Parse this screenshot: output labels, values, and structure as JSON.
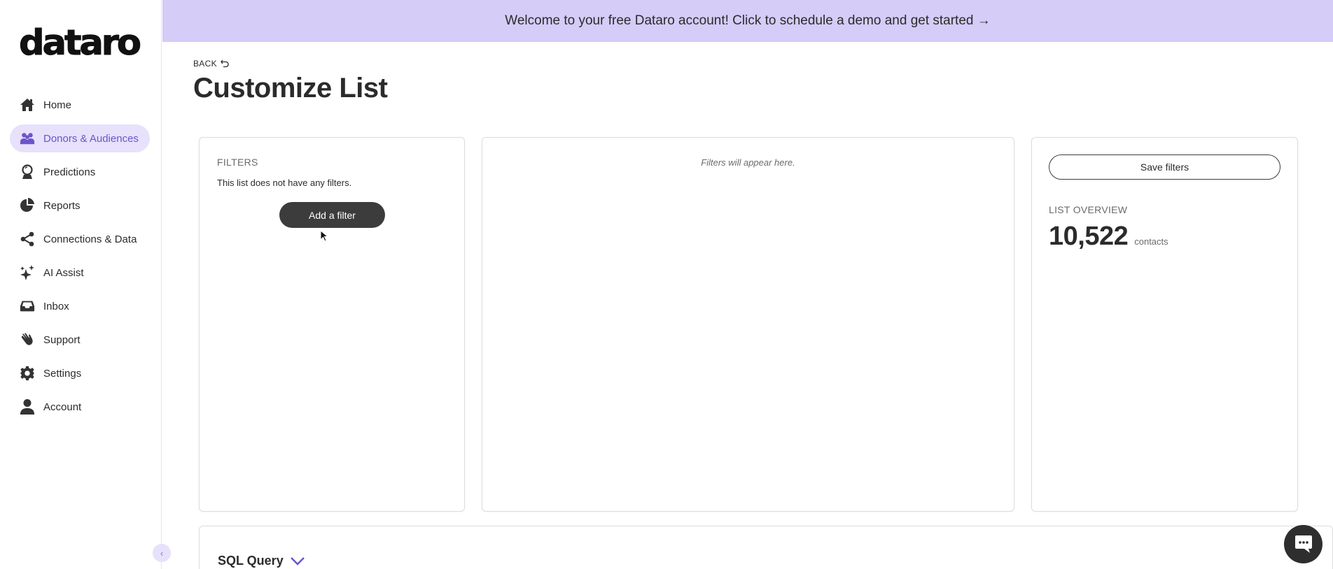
{
  "app": {
    "logo_text": "dataro"
  },
  "banner": {
    "text": "Welcome to your free Dataro account! Click to schedule a demo and get started →"
  },
  "sidebar": {
    "items": [
      {
        "label": "Home",
        "icon": "home-icon",
        "active": false
      },
      {
        "label": "Donors & Audiences",
        "icon": "people-icon",
        "active": true
      },
      {
        "label": "Predictions",
        "icon": "crystal-ball-icon",
        "active": false
      },
      {
        "label": "Reports",
        "icon": "pie-chart-icon",
        "active": false
      },
      {
        "label": "Connections & Data",
        "icon": "share-icon",
        "active": false
      },
      {
        "label": "AI Assist",
        "icon": "sparkle-icon",
        "active": false
      },
      {
        "label": "Inbox",
        "icon": "inbox-icon",
        "active": false
      },
      {
        "label": "Support",
        "icon": "waving-hand-icon",
        "active": false
      },
      {
        "label": "Settings",
        "icon": "gear-icon",
        "active": false
      },
      {
        "label": "Account",
        "icon": "user-icon",
        "active": false
      }
    ],
    "collapse_glyph": "‹"
  },
  "header": {
    "back_label": "BACK",
    "title": "Customize List"
  },
  "filters_card": {
    "label": "FILTERS",
    "empty_text": "This list does not have any filters.",
    "add_button": "Add a filter"
  },
  "middle_card": {
    "placeholder": "Filters will appear here."
  },
  "overview_card": {
    "save_button": "Save filters",
    "label": "LIST OVERVIEW",
    "count": "10,522",
    "unit": "contacts"
  },
  "sql_card": {
    "title": "SQL Query"
  },
  "colors": {
    "accent": "#6b55c9",
    "accent_light": "#e7e1fb",
    "banner_bg": "#d5ccf7",
    "dark_button": "#3c3c3c"
  }
}
